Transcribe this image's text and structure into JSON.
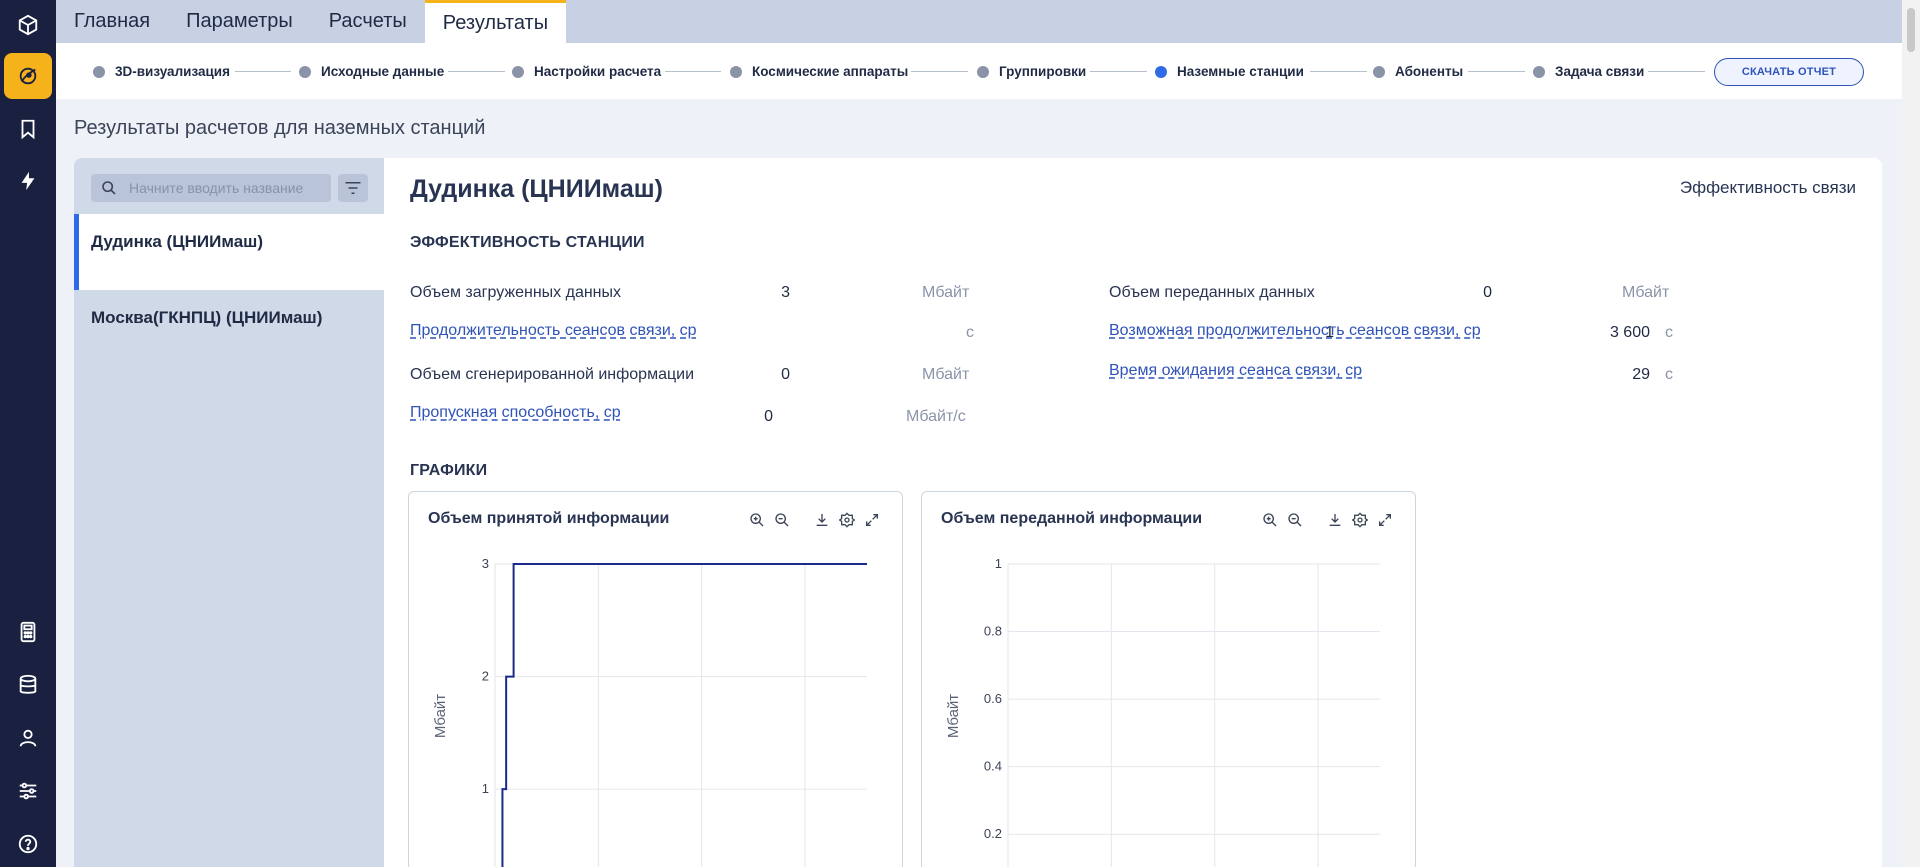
{
  "topnav": {
    "tabs": [
      {
        "label": "Главная"
      },
      {
        "label": "Параметры"
      },
      {
        "label": "Расчеты"
      },
      {
        "label": "Результаты"
      }
    ],
    "active_index": 3,
    "accent_color": "#f6b21b"
  },
  "rail": {
    "icons": [
      "cube-icon",
      "orbit-icon",
      "bookmark-icon",
      "lightning-icon",
      "calculator-icon",
      "database-icon",
      "user-icon",
      "sliders-icon",
      "help-icon"
    ],
    "active_icon": "orbit-icon"
  },
  "steps": {
    "items": [
      {
        "label": "3D-визуализация",
        "active": false
      },
      {
        "label": "Исходные данные",
        "active": false
      },
      {
        "label": "Настройки расчета",
        "active": false
      },
      {
        "label": "Космические аппараты",
        "active": false
      },
      {
        "label": "Группировки",
        "active": false
      },
      {
        "label": "Наземные станции",
        "active": true
      },
      {
        "label": "Абоненты",
        "active": false
      },
      {
        "label": "Задача связи",
        "active": false
      }
    ],
    "download_label": "СКАЧАТЬ ОТЧЕТ"
  },
  "page": {
    "title": "Результаты расчетов для наземных станций"
  },
  "list": {
    "search_placeholder": "Начните вводить название",
    "stations": [
      {
        "name": "Дудинка (ЦНИИмаш)",
        "active": true
      },
      {
        "name": "Москва(ГКНПЦ) (ЦНИИмаш)",
        "active": false
      }
    ]
  },
  "detail": {
    "station_name": "Дудинка (ЦНИИмаш)",
    "efficiency_link": "Эффективность связи",
    "section_efficiency": "ЭФФЕКТИВНОСТЬ СТАНЦИИ",
    "section_charts": "ГРАФИКИ",
    "metrics_left": [
      {
        "label": "Объем загруженных данных",
        "value": "3",
        "unit": "Мбайт",
        "link": false
      },
      {
        "label": "Продолжительность сеансов связи, ср",
        "value": "1",
        "unit": "с",
        "link": true
      },
      {
        "label": "Объем сгенерированной информации",
        "value": "0",
        "unit": "Мбайт",
        "link": false
      },
      {
        "label": "Пропускная способность, ср",
        "value": "0",
        "unit": "Мбайт/с",
        "link": true
      }
    ],
    "metrics_right": [
      {
        "label": "Объем переданных данных",
        "value": "0",
        "unit": "Мбайт",
        "link": false
      },
      {
        "label": "Возможная продолжительность сеансов связи, ср",
        "value": "3 600",
        "unit": "с",
        "link": true
      },
      {
        "label": "Время ожидания сеанса связи, ср",
        "value": "29",
        "unit": "с",
        "link": true
      }
    ]
  },
  "chart_data": [
    {
      "type": "line",
      "title": "Объем принятой информации",
      "ylabel": "Мбайт",
      "xlabel": "",
      "ylim_visible": [
        0.3,
        3
      ],
      "yticks": [
        "1",
        "2",
        "3"
      ],
      "grid": true,
      "color": "#1b2a8a",
      "series": [
        {
          "points": [
            [
              0,
              0
            ],
            [
              0.02,
              0
            ],
            [
              0.02,
              1
            ],
            [
              0.03,
              1
            ],
            [
              0.03,
              2
            ],
            [
              0.05,
              2
            ],
            [
              0.05,
              3
            ],
            [
              1,
              3
            ]
          ]
        }
      ]
    },
    {
      "type": "line",
      "title": "Объем переданной информации",
      "ylabel": "Мбайт",
      "xlabel": "",
      "ylim_visible": [
        0.1,
        1
      ],
      "yticks": [
        "0.2",
        "0.4",
        "0.6",
        "0.8",
        "1"
      ],
      "grid": true,
      "color": "#1b2a8a",
      "series": []
    }
  ]
}
